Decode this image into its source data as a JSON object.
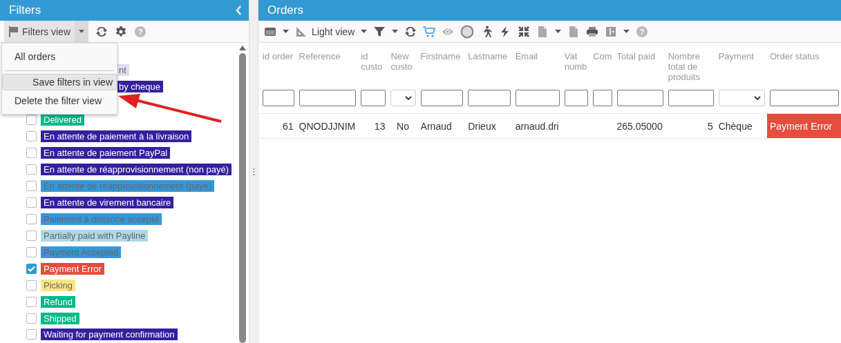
{
  "filters_panel": {
    "title": "Filters",
    "toolbar": {
      "view_button": "Filters view",
      "help": "?"
    },
    "view_menu": {
      "items": [
        {
          "label": "All orders",
          "selected": false,
          "kind": "item"
        },
        {
          "kind": "divider"
        },
        {
          "label": "Save filters in view",
          "selected": true,
          "kind": "item"
        },
        {
          "label": "Delete the filter view",
          "selected": false,
          "kind": "item"
        }
      ]
    },
    "statuses": [
      {
        "label": "nt",
        "color": "#e1ddf7",
        "kind": "partial"
      },
      {
        "label": "by cheque",
        "color": "#34209e",
        "kind": "partial"
      },
      {
        "label": "Delivered",
        "color": "#01b887",
        "checked": false,
        "kind": "full"
      },
      {
        "label": "En attente de paiement à la livraison",
        "color": "#34209e",
        "checked": false,
        "kind": "full"
      },
      {
        "label": "En attente de paiement PayPal",
        "color": "#34209e",
        "checked": false,
        "kind": "full"
      },
      {
        "label": "En attente de réapprovisionnement (non payé)",
        "color": "#34209e",
        "checked": false,
        "kind": "full"
      },
      {
        "label": "En attente de réapprovisionnement (payé)",
        "color": "#3498db",
        "checked": false,
        "kind": "full"
      },
      {
        "label": "En attente de virement bancaire",
        "color": "#34209e",
        "checked": false,
        "kind": "full"
      },
      {
        "label": "Paiement à distance accepté",
        "color": "#3498db",
        "checked": false,
        "kind": "full"
      },
      {
        "label": "Partially paid with Payline",
        "color": "#add8e6",
        "checked": false,
        "kind": "full"
      },
      {
        "label": "Payment Accepted",
        "color": "#3498db",
        "checked": false,
        "kind": "full"
      },
      {
        "label": "Payment Error",
        "color": "#e74c3c",
        "checked": true,
        "kind": "full"
      },
      {
        "label": "Picking",
        "color": "#fee582",
        "checked": false,
        "kind": "full"
      },
      {
        "label": "Refund",
        "color": "#01b887",
        "checked": false,
        "kind": "full"
      },
      {
        "label": "Shipped",
        "color": "#01b887",
        "checked": false,
        "kind": "full"
      },
      {
        "label": "Waiting for payment confirmation",
        "color": "#34209e",
        "checked": false,
        "kind": "full"
      }
    ]
  },
  "orders_panel": {
    "title": "Orders",
    "toolbar": {
      "view_button": "Light view",
      "help": "?"
    },
    "table": {
      "columns": [
        {
          "label": "id order",
          "kind": "input"
        },
        {
          "label": "Reference",
          "kind": "input"
        },
        {
          "label": "id custo",
          "kind": "input"
        },
        {
          "label": "New custo",
          "kind": "select"
        },
        {
          "label": "Firstname",
          "kind": "input"
        },
        {
          "label": "Lastname",
          "kind": "input"
        },
        {
          "label": "Email",
          "kind": "input"
        },
        {
          "label": "Vat numb",
          "kind": "input"
        },
        {
          "label": "Com",
          "kind": "input"
        },
        {
          "label": "Total paid",
          "kind": "input"
        },
        {
          "label": "Nombre total de produits",
          "kind": "input"
        },
        {
          "label": "Payment",
          "kind": "select"
        },
        {
          "label": "Order status",
          "kind": "input"
        }
      ],
      "rows": [
        {
          "cells": [
            "61",
            "QNODJJNIM",
            "13",
            "No",
            "Arnaud",
            "Drieux",
            "arnaud.dri",
            "",
            "",
            "265.05000",
            "5",
            "Chèque",
            "Payment Error"
          ],
          "color": "#e74c3c"
        }
      ]
    }
  }
}
